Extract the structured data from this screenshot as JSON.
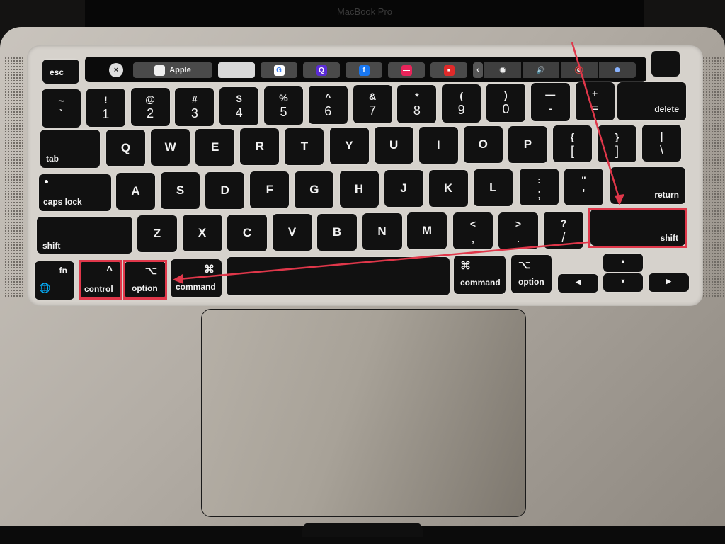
{
  "lid": {
    "label": "MacBook Pro"
  },
  "touch_bar": {
    "close_icon": "×",
    "items": [
      {
        "name": "apple-site",
        "label": "Apple",
        "icon": ""
      },
      {
        "name": "apple-favorite",
        "label": "",
        "icon": ""
      },
      {
        "name": "google",
        "label": "",
        "icon": "G"
      },
      {
        "name": "search-app",
        "label": "",
        "icon": "Q"
      },
      {
        "name": "facebook",
        "label": "",
        "icon": "f"
      },
      {
        "name": "red-app",
        "label": "",
        "icon": "—"
      },
      {
        "name": "news-app",
        "label": "",
        "icon": "■"
      }
    ],
    "control_strip": {
      "expand": "‹",
      "brightness": "✹",
      "volume": "🔊",
      "mute": "🔇",
      "siri": "●"
    }
  },
  "keys": {
    "esc": "esc",
    "number_row": [
      {
        "top": "~",
        "bot": "`"
      },
      {
        "top": "!",
        "bot": "1"
      },
      {
        "top": "@",
        "bot": "2"
      },
      {
        "top": "#",
        "bot": "3"
      },
      {
        "top": "$",
        "bot": "4"
      },
      {
        "top": "%",
        "bot": "5"
      },
      {
        "top": "^",
        "bot": "6"
      },
      {
        "top": "&",
        "bot": "7"
      },
      {
        "top": "*",
        "bot": "8"
      },
      {
        "top": "(",
        "bot": "9"
      },
      {
        "top": ")",
        "bot": "0"
      },
      {
        "top": "—",
        "bot": "-"
      },
      {
        "top": "+",
        "bot": "="
      }
    ],
    "delete": "delete",
    "tab": "tab",
    "qwerty_row": [
      "Q",
      "W",
      "E",
      "R",
      "T",
      "Y",
      "U",
      "I",
      "O",
      "P"
    ],
    "bracket_keys": [
      {
        "top": "{",
        "bot": "["
      },
      {
        "top": "}",
        "bot": "]"
      },
      {
        "top": "|",
        "bot": "\\"
      }
    ],
    "caps_lock": "caps lock",
    "home_row": [
      "A",
      "S",
      "D",
      "F",
      "G",
      "H",
      "J",
      "K",
      "L"
    ],
    "home_punct": [
      {
        "top": ":",
        "bot": ";"
      },
      {
        "top": "\"",
        "bot": "'"
      }
    ],
    "return": "return",
    "shift_left": "shift",
    "bottom_row": [
      "Z",
      "X",
      "C",
      "V",
      "B",
      "N",
      "M"
    ],
    "bottom_punct": [
      {
        "top": "<",
        "bot": ","
      },
      {
        "top": ">",
        "bot": "."
      },
      {
        "top": "?",
        "bot": "/"
      }
    ],
    "shift_right": "shift",
    "fn": "fn",
    "globe": "🌐",
    "control": {
      "sym": "^",
      "label": "control"
    },
    "option_left": {
      "sym": "⌥",
      "label": "option"
    },
    "command_left": {
      "sym": "⌘",
      "label": "command"
    },
    "command_right": {
      "sym": "⌘",
      "label": "command"
    },
    "option_right": {
      "sym": "⌥",
      "label": "option"
    },
    "arrows": {
      "left": "◀",
      "up": "▲",
      "down": "▼",
      "right": "▶"
    }
  },
  "annotations": {
    "highlight_color": "#e0374a",
    "highlighted_keys": [
      "control",
      "option",
      "shift (right)"
    ]
  }
}
